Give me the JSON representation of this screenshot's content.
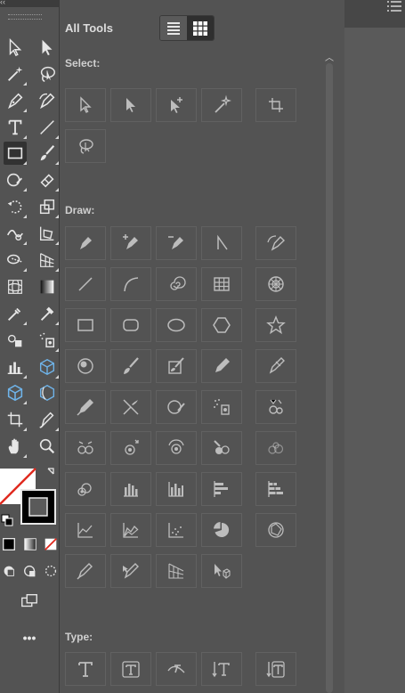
{
  "panel": {
    "title": "All Tools",
    "view_list_icon": "list-view-icon",
    "view_grid_icon": "grid-view-icon",
    "sections": {
      "select": "Select:",
      "draw": "Draw:",
      "type": "Type:"
    }
  },
  "toolbar": {
    "more_label": "•••"
  },
  "colors": {
    "panel_bg": "#535353",
    "tile_border": "#616161",
    "icon": "#c4c4c4"
  }
}
